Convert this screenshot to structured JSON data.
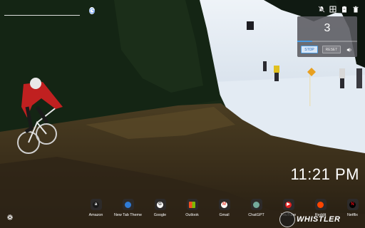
{
  "search": {
    "value": "",
    "placeholder": ""
  },
  "top_icons": [
    "no-bell-icon",
    "grid-icon",
    "clipboard-icon",
    "trash-icon"
  ],
  "timer": {
    "count": "3",
    "stop_label": "STOP",
    "reset_label": "RESET",
    "progress": 0.25
  },
  "clock": "11:21 PM",
  "shortcuts": [
    {
      "label": "Amazon",
      "icon_text": "a",
      "color": "#ffffff",
      "bg": "#1a1a1a"
    },
    {
      "label": "New Tab Theme",
      "icon_text": "",
      "color": "#2f7bd6",
      "bg": "#2f7bd6"
    },
    {
      "label": "Google",
      "icon_text": "G",
      "color": "#333333",
      "bg": "#ffffff"
    },
    {
      "label": "Outlook",
      "icon_text": "",
      "color": "#ffffff",
      "bg": "multi"
    },
    {
      "label": "Gmail",
      "icon_text": "M",
      "color": "#ea4335",
      "bg": "#ffffff"
    },
    {
      "label": "ChatGPT",
      "icon_text": "",
      "color": "#ffffff",
      "bg": "#74aa9c"
    },
    {
      "label": "YouTube",
      "icon_text": "▶",
      "color": "#ffffff",
      "bg": "#e02020"
    },
    {
      "label": "Reddit",
      "icon_text": "",
      "color": "#ffffff",
      "bg": "#ff4500"
    },
    {
      "label": "Netflix",
      "icon_text": "N",
      "color": "#e50914",
      "bg": "#000000"
    }
  ],
  "logo": {
    "word": "WHISTLER"
  }
}
